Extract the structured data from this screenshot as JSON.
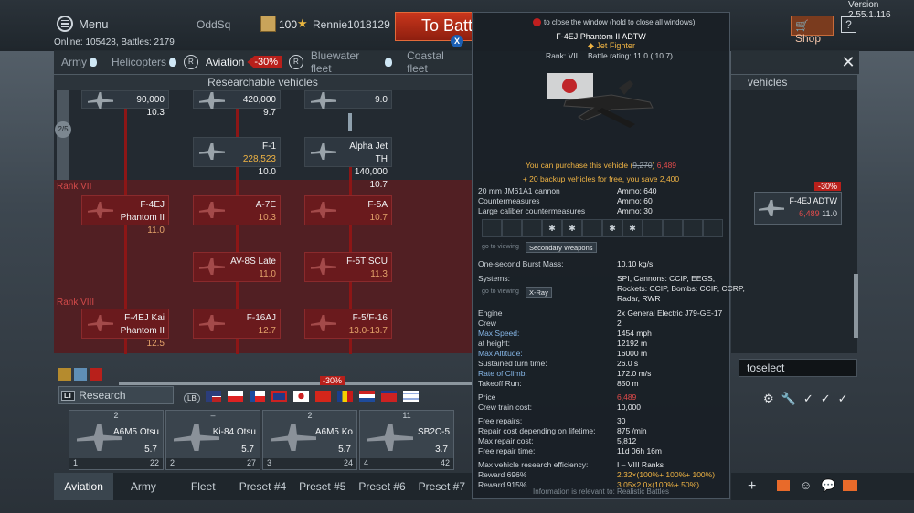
{
  "header": {
    "menu": "Menu",
    "squad": "OddSq",
    "level": "100",
    "username": "Rennie1018129",
    "battle": "To Battle",
    "version": "Version 2.55.1.116",
    "shop": "Shop",
    "help": "?",
    "online": "Online: 105428, Battles: 2179"
  },
  "tabs": [
    {
      "label": "Army"
    },
    {
      "label": "Helicopters"
    },
    {
      "label": "Aviation",
      "discount": "-30%"
    },
    {
      "label": "Bluewater fleet"
    },
    {
      "label": "Coastal fleet"
    }
  ],
  "tree": {
    "header": "Researchable vehicles",
    "side_header": "vehicles",
    "rank7": "Rank VII",
    "rank8": "Rank VIII",
    "arrow_label": "2/5",
    "top_cards": [
      {
        "cost": "90,000",
        "br": "10.3"
      },
      {
        "cost": "420,000",
        "br": "9.7"
      },
      {
        "br": "9.0"
      }
    ],
    "mid_cards": [
      {
        "name": "F-1",
        "cost": "228,523",
        "br": "10.0"
      },
      {
        "name": "Alpha Jet TH",
        "cost": "140,000",
        "br": "10.7"
      }
    ],
    "cards": [
      {
        "name": "F-4EJ Phantom II",
        "br": "11.0"
      },
      {
        "name": "A-7E",
        "br": "10.3"
      },
      {
        "name": "F-5A",
        "br": "10.7"
      },
      {
        "name": "AV-8S Late",
        "br": "11.0"
      },
      {
        "name": "F-5T SCU",
        "br": "11.3"
      },
      {
        "name": "F-4EJ Kai Phantom II",
        "br": "12.5"
      },
      {
        "name": "F-16AJ",
        "br": "12.7"
      },
      {
        "name": "F-5/F-16",
        "br": "13.0-13.7"
      }
    ],
    "right_card": {
      "name": "F-4EJ ADTW",
      "cost": "6,489",
      "br": "11.0",
      "discount": "-30%"
    }
  },
  "research": {
    "label": "Research",
    "badge": "LT",
    "lb": "LB",
    "discount": "-30%"
  },
  "crew": [
    {
      "slot": "2",
      "name": "A6M5 Otsu",
      "br": "5.7",
      "left": "1",
      "right": "22"
    },
    {
      "slot": "–",
      "name": "Ki-84 Otsu",
      "br": "5.7",
      "left": "2",
      "right": "27"
    },
    {
      "slot": "2",
      "name": "A6M5 Ko",
      "br": "5.7",
      "left": "3",
      "right": "24"
    },
    {
      "slot": "11",
      "name": "SB2C-5",
      "br": "3.7",
      "left": "4",
      "right": "42"
    }
  ],
  "bottom_tabs": [
    "Aviation",
    "Army",
    "Fleet",
    "Preset #4",
    "Preset #5",
    "Preset #6",
    "Preset #7"
  ],
  "toselect": "toselect",
  "tooltip": {
    "hint": "to close the window (hold to close all windows)",
    "title": "F-4EJ Phantom II ADTW",
    "type": "Jet Fighter",
    "rank": "Rank: VII",
    "battle_rating": "Battle rating: 11.0 (  10.7)",
    "purchase_prefix": "You can purchase this vehicle (",
    "purchase_old": "9,270",
    "purchase_new": "6,489",
    "backup": "+ 20 backup vehicles for free, you save 2,400",
    "weapons": [
      {
        "k": "20 mm JM61A1 cannon",
        "v": "Ammo: 640"
      },
      {
        "k": "Countermeasures",
        "v": "Ammo: 60"
      },
      {
        "k": "Large caliber countermeasures",
        "v": "Ammo: 30"
      }
    ],
    "goto": "go to viewing",
    "secondary": "Secondary Weapons",
    "xray": "X-Ray",
    "burst_k": "One-second Burst Mass:",
    "burst_v": "10.10 kg/s",
    "systems_k": "Systems:",
    "systems_v": [
      "SPI, Cannons:  CCIP, EEGS,",
      "Rockets:  CCIP, Bombs:  CCIP, CCRP,",
      "Radar, RWR"
    ],
    "specs": [
      {
        "k": "Engine",
        "v": "2x  General Electric J79-GE-17"
      },
      {
        "k": "Crew",
        "v": "2"
      },
      {
        "k": "Max Speed:",
        "v": "1454 mph"
      },
      {
        "k": "at height:",
        "v": "12192 m"
      },
      {
        "k": "Max Altitude:",
        "v": "16000 m"
      },
      {
        "k": "Sustained turn time:",
        "v": "26.0 s"
      },
      {
        "k": "Rate of Climb:",
        "v": "172.0 m/s"
      },
      {
        "k": "Takeoff Run:",
        "v": "850 m"
      }
    ],
    "economy": [
      {
        "k": "Price",
        "v": "6,489"
      },
      {
        "k": "Crew train cost:",
        "v": "10,000"
      }
    ],
    "repair": [
      {
        "k": "Free repairs:",
        "v": "30"
      },
      {
        "k": "Repair cost depending on lifetime:",
        "v": "875 /min"
      },
      {
        "k": "Max repair cost:",
        "v": "5,812"
      },
      {
        "k": "Free repair time:",
        "v": "11d 06h 16m"
      }
    ],
    "rewards": [
      {
        "k": "Max vehicle research efficiency:",
        "v": "I – VIII Ranks"
      },
      {
        "k": "Reward 696%",
        "v": "2.32×(100%+ 100%+ 100%)"
      },
      {
        "k": "Reward 915%",
        "v": "3.05×2.0×(100%+ 50%)"
      }
    ],
    "footnote": "Information is relevant to:   Realistic Battles"
  },
  "colors": {
    "accent_red": "#b8201b",
    "gold": "#f0b444",
    "blue": "#86b6e6"
  }
}
